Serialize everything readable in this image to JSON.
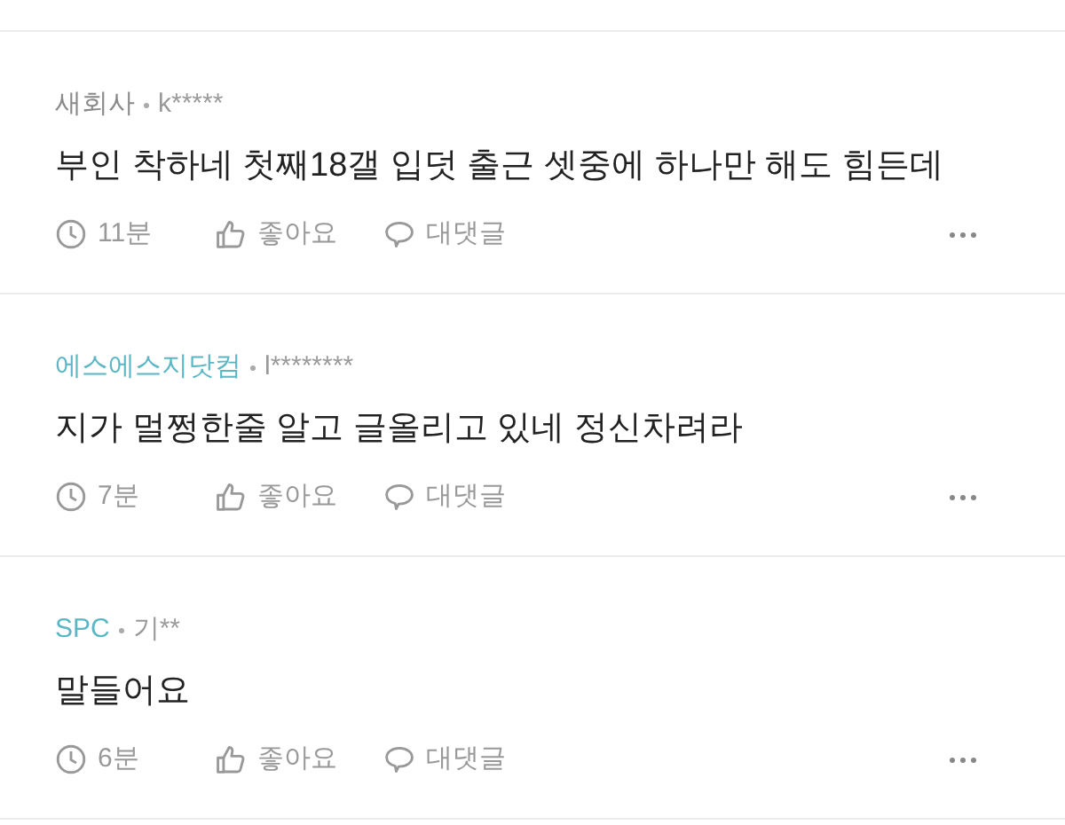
{
  "comments": [
    {
      "company": "새회사",
      "color": "#8a8a8a",
      "author": "k*****",
      "text": "부인 착하네 첫째18갤 입덧 출근 셋중에 하나만 해도 힘든데",
      "time": "11분",
      "like_label": "좋아요",
      "reply_label": "대댓글"
    },
    {
      "company": "에스에스지닷컴",
      "color": "#5bb7c4",
      "author": "l********",
      "text": "지가 멀쩡한줄 알고 글올리고 있네 정신차려라",
      "time": "7분",
      "like_label": "좋아요",
      "reply_label": "대댓글"
    },
    {
      "company": "SPC",
      "color": "#5bb7c4",
      "author": "기**",
      "text": "말들어요",
      "time": "6분",
      "like_label": "좋아요",
      "reply_label": "대댓글"
    }
  ]
}
